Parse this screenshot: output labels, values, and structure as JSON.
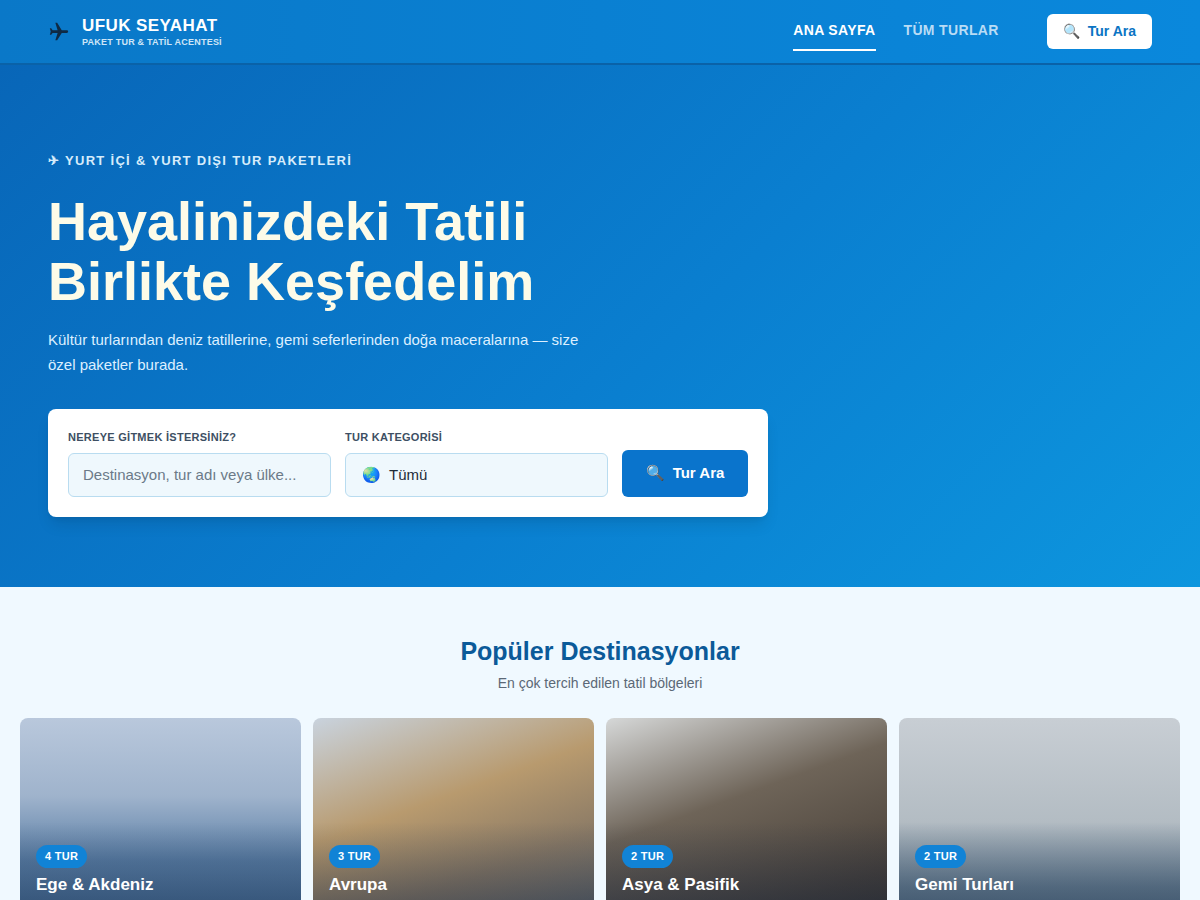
{
  "header": {
    "brand": "UFUK SEYAHAT",
    "tagline": "PAKET TUR & TATİL ACENTESİ",
    "nav": [
      {
        "label": "ANA SAYFA",
        "selected": true
      },
      {
        "label": "TÜM TURLAR",
        "selected": false
      }
    ],
    "search_button": {
      "icon": "🔍",
      "label": "Tur Ara"
    }
  },
  "hero": {
    "eyebrow": "✈ YURT İÇİ & YURT DIŞI TUR PAKETLERİ",
    "title_lines": [
      "Hayalinizdeki Tatili",
      "Birlikte Keşfedelim"
    ],
    "subtitle": "Kültür turlarından deniz tatillerine, gemi seferlerinden doğa maceralarına — size özel paketler burada.",
    "search": {
      "destination_label": "NEREYE GİTMEK İSTERSİNİZ?",
      "destination_placeholder": "Destinasyon, tur adı veya ülke...",
      "category_label": "TUR KATEGORİSİ",
      "category_icon": "🌏",
      "category_value": "Tümü",
      "button_icon": "🔍",
      "button_label": "Tur Ara"
    }
  },
  "destinations": {
    "title": "Popüler Destinasyonlar",
    "subtitle": "En çok tercih edilen tatil bölgeleri",
    "cards": [
      {
        "badge": "4 TUR",
        "name": "Ege & Akdeniz"
      },
      {
        "badge": "3 TUR",
        "name": "Avrupa"
      },
      {
        "badge": "2 TUR",
        "name": "Asya & Pasifik"
      },
      {
        "badge": "2 TUR",
        "name": "Gemi Turları"
      }
    ]
  }
}
